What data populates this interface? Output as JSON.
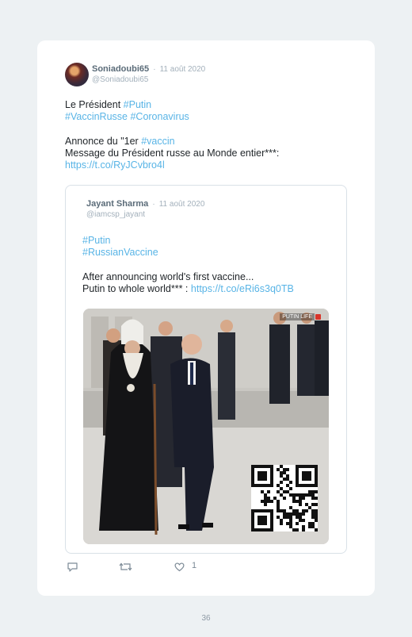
{
  "tweet": {
    "author_name": "Soniadoubi65",
    "separator": "·",
    "date": "11 août 2020",
    "handle": "@Soniadoubi65",
    "lines": [
      [
        {
          "text": "Le Président ",
          "link": false
        },
        {
          "text": "#Putin",
          "link": true
        }
      ],
      [
        {
          "text": "#VaccinRusse",
          "link": true
        },
        {
          "text": " ",
          "link": false
        },
        {
          "text": "#Coronavirus",
          "link": true
        }
      ],
      [],
      [
        {
          "text": "Annonce du \"1er ",
          "link": false
        },
        {
          "text": "#vaccin",
          "link": true
        }
      ],
      [
        {
          "text": "Message du Président russe au Monde entier***:",
          "link": false
        }
      ],
      [
        {
          "text": "https://t.co/RyJCvbro4l",
          "link": true
        }
      ]
    ]
  },
  "quoted_tweet": {
    "author_name": "Jayant Sharma",
    "separator": "·",
    "date": "11 août 2020",
    "handle": "@iamcsp_jayant",
    "lines": [
      [
        {
          "text": "#Putin",
          "link": true
        }
      ],
      [
        {
          "text": "#RussianVaccine",
          "link": true
        }
      ],
      [],
      [
        {
          "text": "After announcing world's first vaccine...",
          "link": false
        }
      ],
      [
        {
          "text": "Putin to whole world*** : ",
          "link": false
        },
        {
          "text": "https://t.co/eRi6s3q0TB",
          "link": true
        }
      ]
    ],
    "media": {
      "watermark": "PUTIN LIFE"
    }
  },
  "actions": {
    "reply_icon": "reply-icon",
    "retweet_icon": "retweet-icon",
    "like_icon": "heart-icon",
    "like_count": "1"
  },
  "page_number": "36",
  "colors": {
    "link": "#58b4e6",
    "text": "#1f2428",
    "muted": "#a3b0bb",
    "background": "#edf1f3",
    "card": "#ffffff"
  }
}
